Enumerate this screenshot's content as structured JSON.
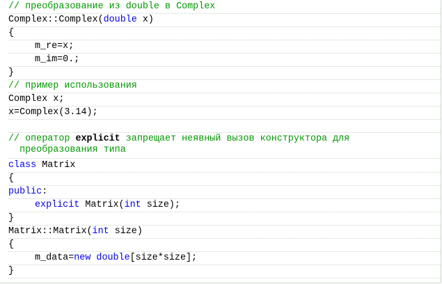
{
  "code": {
    "l1_comment": "// преобразование из double в Complex",
    "l2_a": "Complex::Complex(",
    "l2_kw": "double",
    "l2_b": " x)",
    "l3": "{",
    "l4": "m_re=x;",
    "l5": "m_im=0.;",
    "l6": "}",
    "l7_comment": "// пример использования",
    "l8": "Complex x;",
    "l9": "x=Complex(3.14);",
    "l11_comment_a": "// оператор ",
    "l11_bold": "explicit",
    "l11_comment_b": " запрещает неявный вызов конструктора для",
    "l11_comment_c": "  преобразования типа",
    "l12_kw": "class",
    "l12_b": " Matrix",
    "l13": "{",
    "l14_kw": "public",
    "l14_b": ":",
    "l15_kw": "explicit",
    "l15_a": " Matrix(",
    "l15_kw2": "int",
    "l15_b": " size);",
    "l16": "}",
    "l17_a": "Matrix::Matrix(",
    "l17_kw": "int",
    "l17_b": " size)",
    "l18": "{",
    "l19_a": "m_data=",
    "l19_kw": "new",
    "l19_b": " ",
    "l19_kw2": "double",
    "l19_c": "[size*size];",
    "l20": "}"
  }
}
